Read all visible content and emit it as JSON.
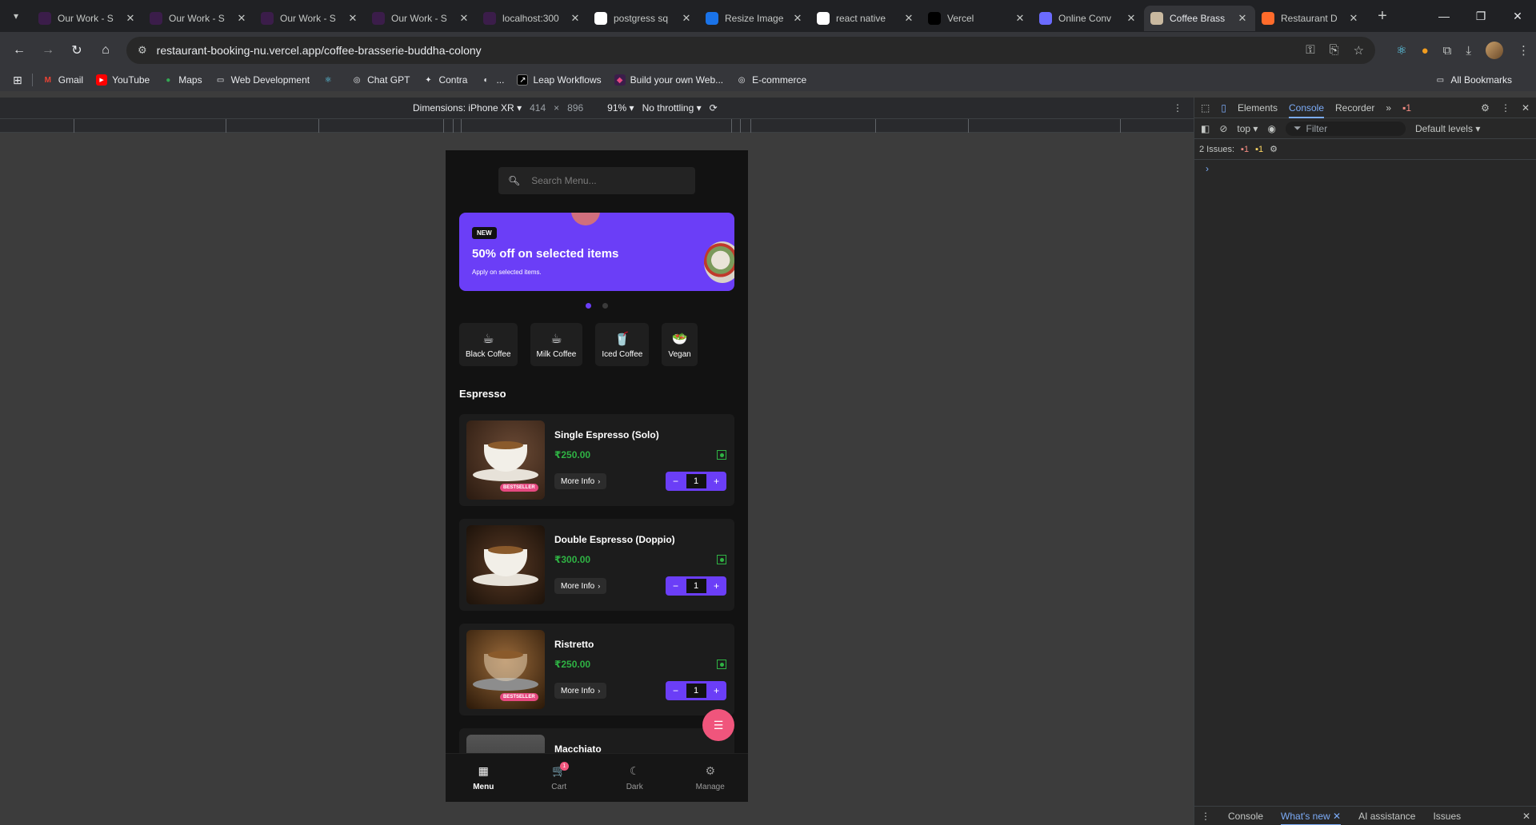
{
  "browser": {
    "tabs": [
      {
        "title": "Our Work - S",
        "fav_color": "#3b1d4a"
      },
      {
        "title": "Our Work - S",
        "fav_color": "#3b1d4a"
      },
      {
        "title": "Our Work - S",
        "fav_color": "#3b1d4a"
      },
      {
        "title": "Our Work - S",
        "fav_color": "#3b1d4a"
      },
      {
        "title": "localhost:300",
        "fav_color": "#3b1d4a"
      },
      {
        "title": "postgress sq",
        "fav_color": "#ffffff"
      },
      {
        "title": "Resize Image",
        "fav_color": "#1a73e8"
      },
      {
        "title": "react native",
        "fav_color": "#ffffff"
      },
      {
        "title": "Vercel",
        "fav_color": "#000000"
      },
      {
        "title": "Online Conv",
        "fav_color": "#6b6bff"
      },
      {
        "title": "Coffee Brass",
        "fav_color": "#c9b9a0",
        "active": true
      },
      {
        "title": "Restaurant D",
        "fav_color": "#ff6b2b"
      }
    ],
    "url": "restaurant-booking-nu.vercel.app/coffee-brasserie-buddha-colony",
    "bookmarks": [
      "Gmail",
      "YouTube",
      "Maps",
      "Web Development",
      "Chat GPT",
      "Contra",
      "...",
      "Leap Workflows",
      "Build your own Web...",
      "E-commerce"
    ],
    "all_bookmarks": "All Bookmarks"
  },
  "device_toolbar": {
    "dimensions_label": "Dimensions: iPhone XR",
    "width": "414",
    "times": "×",
    "height": "896",
    "zoom": "91%",
    "throttling": "No throttling"
  },
  "app": {
    "search_placeholder": "Search Menu...",
    "banner": {
      "tag": "NEW",
      "title": "50% off on selected items",
      "subtitle": "Apply on selected items."
    },
    "categories": [
      {
        "label": "Black Coffee",
        "icon": "☕"
      },
      {
        "label": "Milk Coffee",
        "icon": "☕"
      },
      {
        "label": "Iced Coffee",
        "icon": "🥤"
      },
      {
        "label": "Vegan",
        "icon": "🥗"
      }
    ],
    "section": "Espresso",
    "more_info": "More Info",
    "items": [
      {
        "name": "Single Espresso (Solo)",
        "price": "₹250.00",
        "qty": "1",
        "badge": "BESTSELLER"
      },
      {
        "name": "Double Espresso (Doppio)",
        "price": "₹300.00",
        "qty": "1",
        "badge": ""
      },
      {
        "name": "Ristretto",
        "price": "₹250.00",
        "qty": "1",
        "badge": "BESTSELLER"
      },
      {
        "name": "Macchiato",
        "price": "",
        "qty": "",
        "badge": ""
      }
    ],
    "nav": [
      {
        "label": "Menu",
        "icon": "▦",
        "active": true
      },
      {
        "label": "Cart",
        "icon": "🛒",
        "count": "1"
      },
      {
        "label": "Dark",
        "icon": "☾"
      },
      {
        "label": "Manage",
        "icon": "⚙"
      }
    ]
  },
  "devtools": {
    "tabs": [
      "Elements",
      "Console",
      "Recorder"
    ],
    "active_tab": "Console",
    "error_count": "1",
    "context": "top",
    "filter_placeholder": "Filter",
    "levels": "Default levels",
    "issues_label": "2 Issues:",
    "issues_err": "1",
    "issues_warn": "1",
    "drawer_tabs": [
      "Console",
      "What's new",
      "AI assistance",
      "Issues"
    ]
  }
}
